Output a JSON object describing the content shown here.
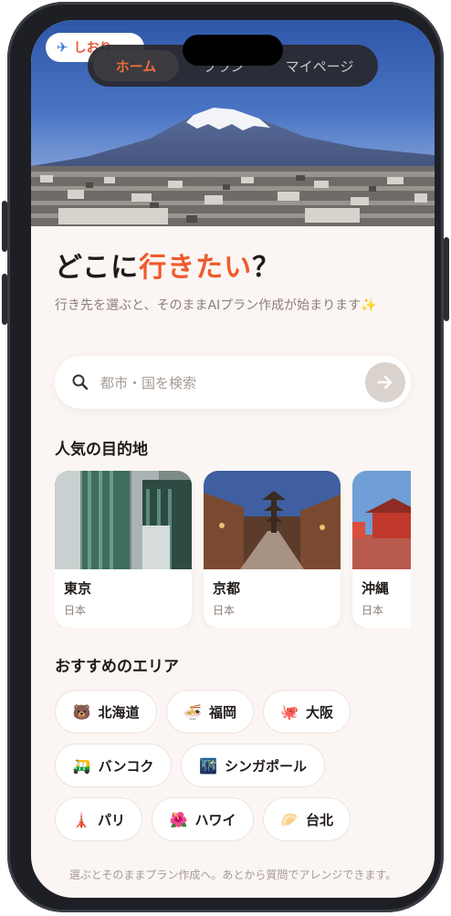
{
  "header": {
    "travel_chip": {
      "icon": "airplane-icon",
      "label": "しおり"
    },
    "tabs": [
      {
        "label": "ホーム",
        "active": true
      },
      {
        "label": "プラン",
        "active": false
      },
      {
        "label": "マイページ",
        "active": false
      }
    ]
  },
  "hero": {
    "image": "mount-fuji-cityscape"
  },
  "main": {
    "title_prefix": "どこに",
    "title_accent": "行きたい",
    "title_suffix": "？",
    "subtitle": "行き先を選ぶと、そのままAIプラン作成が始まります✨",
    "search": {
      "placeholder": "都市・国を検索",
      "icon": "search-icon",
      "submit_icon": "arrow-right-icon"
    },
    "popular_title": "人気の目的地",
    "destinations": [
      {
        "name": "東京",
        "country": "日本"
      },
      {
        "name": "京都",
        "country": "日本"
      },
      {
        "name": "沖縄",
        "country": "日本"
      }
    ],
    "areas_title": "おすすめのエリア",
    "areas": [
      {
        "emoji": "🐻",
        "label": "北海道"
      },
      {
        "emoji": "🍜",
        "label": "福岡"
      },
      {
        "emoji": "🐙",
        "label": "大阪"
      },
      {
        "emoji": "🛺",
        "label": "バンコク"
      },
      {
        "emoji": "🌃",
        "label": "シンガポール"
      },
      {
        "emoji": "🗼",
        "label": "パリ"
      },
      {
        "emoji": "🌺",
        "label": "ハワイ"
      },
      {
        "emoji": "🥟",
        "label": "台北"
      }
    ],
    "footer": "選ぶとそのままプラン作成へ。あとから質問でアレンジできます。"
  },
  "colors": {
    "accent": "#ef5a2e",
    "background": "#fbf6f3",
    "frame": "#1d1f24"
  }
}
